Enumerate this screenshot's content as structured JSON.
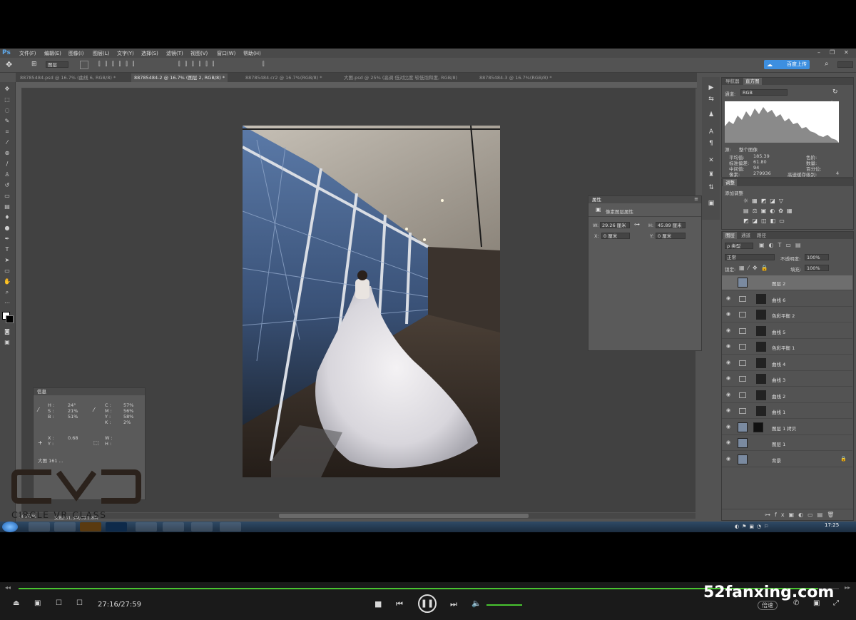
{
  "app": {
    "logo": "Ps"
  },
  "menus": [
    "文件(F)",
    "编辑(E)",
    "图像(I)",
    "图层(L)",
    "文字(Y)",
    "选择(S)",
    "滤镜(T)",
    "视图(V)",
    "窗口(W)",
    "帮助(H)"
  ],
  "options_bar": {
    "layer_select": "图层",
    "cloud_button": "百度上传"
  },
  "tabs": [
    {
      "label": "88785484.psd @ 16.7% (曲线 6, RGB/8) *"
    },
    {
      "label": "88785484-2 @ 16.7% (图层 2, RGB/8) *"
    },
    {
      "label": "88785484.cr2 @ 16.7%(RGB/8) *"
    },
    {
      "label": "大图.psd @ 25% (高调 低对比度 较低饱和度, RGB/8)"
    },
    {
      "label": "88785484-3 @ 16.7%(RGB/8) *"
    }
  ],
  "status": {
    "zoom": "16.67%",
    "doc": "文档:51.3M/321.8M"
  },
  "histogram": {
    "tabs": [
      "导航器",
      "直方图"
    ],
    "channel_label": "通道:",
    "channel": "RGB",
    "source_label": "源:",
    "source": "整个图像",
    "stats_left": [
      [
        "平均值:",
        "185.39"
      ],
      [
        "标准偏差:",
        "61.80"
      ],
      [
        "中间值:",
        "94"
      ],
      [
        "像素:",
        "279936"
      ]
    ],
    "stats_right": [
      [
        "色阶:",
        ""
      ],
      [
        "数量:",
        ""
      ],
      [
        "百分位:",
        ""
      ],
      [
        "高速缓存级别:",
        "4"
      ]
    ]
  },
  "adjustments": {
    "tabs": [
      "调整"
    ],
    "title": "添加调整"
  },
  "properties": {
    "title": "属性",
    "subtitle": "像素图层属性",
    "w_label": "W:",
    "w": "29.26 厘米",
    "h_label": "H:",
    "h": "45.89 厘米",
    "x_label": "X:",
    "x": "0 厘米",
    "y_label": "Y:",
    "y": "0 厘米"
  },
  "layers_panel": {
    "tabs": [
      "图层",
      "通道",
      "路径"
    ],
    "filter": "ρ 类型",
    "blend": "正常",
    "opacity_label": "不透明度:",
    "opacity": "100%",
    "lock_label": "锁定:",
    "fill_label": "填充:",
    "fill": "100%",
    "layers": [
      {
        "name": "图层 2",
        "kind": "pixel",
        "selected": true
      },
      {
        "name": "曲线 6",
        "kind": "adj"
      },
      {
        "name": "色彩平衡 2",
        "kind": "adj"
      },
      {
        "name": "曲线 5",
        "kind": "adj"
      },
      {
        "name": "色彩平衡 1",
        "kind": "adj"
      },
      {
        "name": "曲线 4",
        "kind": "adj"
      },
      {
        "name": "曲线 3",
        "kind": "adj"
      },
      {
        "name": "曲线 2",
        "kind": "adj"
      },
      {
        "name": "曲线 1",
        "kind": "adj"
      },
      {
        "name": "图层 1 拷贝",
        "kind": "pixelmask"
      },
      {
        "name": "图层 1",
        "kind": "pixel"
      },
      {
        "name": "背景",
        "kind": "pixel",
        "locked": true
      }
    ]
  },
  "info_panel": {
    "title": "信息",
    "rows": [
      [
        "H :",
        "24°",
        "C :",
        "57%"
      ],
      [
        "S :",
        "21%",
        "M :",
        "56%"
      ],
      [
        "B :",
        "51%",
        "Y :",
        "58%"
      ],
      [
        "",
        "",
        "K :",
        "2%"
      ]
    ],
    "xy": [
      [
        "X :",
        "0.68",
        "W :",
        ""
      ],
      [
        "Y :",
        "",
        "H :",
        ""
      ]
    ],
    "note": "大图 161 ..."
  },
  "taskbar": {
    "time": "17:25"
  },
  "player": {
    "time": "27:16/27:59",
    "progress": 0.975,
    "volume": 1.0,
    "speed_button": "倍速"
  },
  "watermark": {
    "site": "52fanxing.com",
    "brand_letters": "CVC",
    "brand_text": "CIRCLE VR CLASS"
  },
  "colors": {
    "accent": "#48c430",
    "ps_blue": "#3d8fe0",
    "panel": "#535353"
  }
}
